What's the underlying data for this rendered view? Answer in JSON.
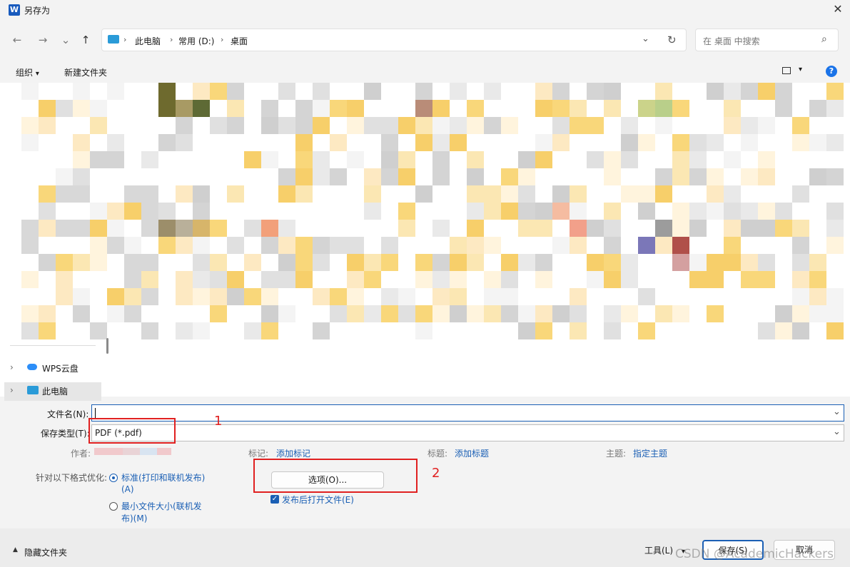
{
  "window": {
    "title": "另存为",
    "app_icon_letter": "W"
  },
  "nav": {
    "back_glyph": "←",
    "forward_glyph": "→",
    "recent_glyph": "⌄",
    "up_glyph": "↑",
    "breadcrumb": [
      "此电脑",
      "常用 (D:)",
      "桌面"
    ],
    "sep_glyph": "›",
    "dropdown_glyph": "⌄",
    "refresh_glyph": "↻"
  },
  "search": {
    "placeholder": "在 桌面 中搜索",
    "icon_glyph": "⌕"
  },
  "toolbar": {
    "organize": "组织",
    "organize_caret": "▾",
    "new_folder": "新建文件夹",
    "view_caret": "▾",
    "help": "?"
  },
  "navpane": {
    "items": [
      {
        "label": "WPS云盘",
        "expand": "›"
      },
      {
        "label": "此电脑",
        "expand": "›"
      }
    ]
  },
  "form": {
    "filename_label": "文件名(N):",
    "filename_value": "",
    "savetype_label": "保存类型(T):",
    "savetype_value": "PDF (*.pdf)",
    "author_label": "作者:",
    "tags_label": "标记:",
    "tags_link": "添加标记",
    "title_label": "标题:",
    "title_link": "添加标题",
    "subject_label": "主题:",
    "subject_link": "指定主题",
    "optimize_label": "针对以下格式优化:",
    "radio_standard_line1": "标准(打印和联机发布)",
    "radio_standard_line2": "(A)",
    "radio_min_line1": "最小文件大小(联机发",
    "radio_min_line2": "布)(M)",
    "options_button": "选项(O)...",
    "open_after_publish": "发布后打开文件(E)",
    "open_after_publish_checked": true,
    "annotation_1": "1",
    "annotation_2": "2"
  },
  "footer": {
    "hide_folders": "隐藏文件夹",
    "tools": "工具(L)",
    "tools_caret": "▾",
    "save": "保存(S)",
    "cancel": "取消",
    "watermark": "CSDN @AcademicHackers"
  },
  "colors": {
    "accent": "#1a5fb4",
    "annotation_red": "#e02020"
  }
}
